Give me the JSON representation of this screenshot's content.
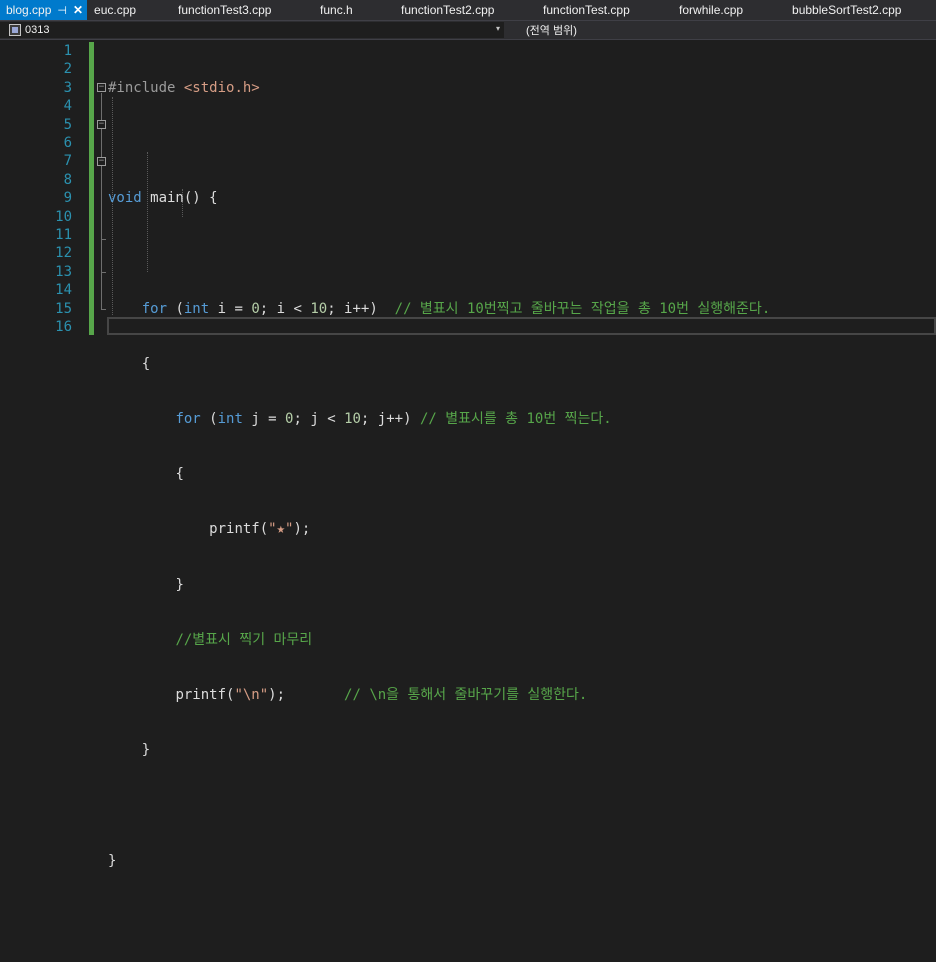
{
  "tabs": [
    {
      "label": "blog.cpp",
      "active": true
    },
    {
      "label": "euc.cpp"
    },
    {
      "label": "functionTest3.cpp"
    },
    {
      "label": "func.h"
    },
    {
      "label": "functionTest2.cpp"
    },
    {
      "label": "functionTest.cpp"
    },
    {
      "label": "forwhile.cpp"
    },
    {
      "label": "bubbleSortTest2.cpp"
    }
  ],
  "tab_pin_glyph": "⊣",
  "tab_close_glyph": "✕",
  "navbar": {
    "project": "0313",
    "scope": "(전역 범위)",
    "dropdown_glyph": "▾"
  },
  "line_numbers": [
    "1",
    "2",
    "3",
    "4",
    "5",
    "6",
    "7",
    "8",
    "9",
    "10",
    "11",
    "12",
    "13",
    "14",
    "15",
    "16"
  ],
  "code": {
    "l1_directive": "#include",
    "l1_header": "<stdio.h>",
    "l3_kw": "void",
    "l3_rest": " main() {",
    "l5_kw_for": "for",
    "l5_paren": " (",
    "l5_kw_int": "int",
    "l5_mid1": " i = ",
    "l5_num0": "0",
    "l5_mid2": "; i < ",
    "l5_num10": "10",
    "l5_mid3": "; i++)  ",
    "l5_comment": "// 별표시 10번찍고 줄바꾸는 작업을 총 10번 실행해준다.",
    "l6_brace": "{",
    "l7_kw_for": "for",
    "l7_paren": " (",
    "l7_kw_int": "int",
    "l7_mid1": " j = ",
    "l7_num0": "0",
    "l7_mid2": "; j < ",
    "l7_num10": "10",
    "l7_mid3": "; j++) ",
    "l7_comment": "// 별표시를 총 10번 찍는다.",
    "l8_brace": "{",
    "l9_call": "printf(",
    "l9_str": "\"★\"",
    "l9_end": ");",
    "l10_brace": "}",
    "l11_comment": "//별표시 찍기 마무리",
    "l12_call": "printf(",
    "l12_str": "\"\\n\"",
    "l12_end": ");       ",
    "l12_comment": "// \\n을 통해서 줄바꾸기를 실행한다.",
    "l13_brace": "}",
    "l15_brace": "}"
  },
  "colors": {
    "tab_active": "#007acc",
    "keyword": "#569cd6",
    "comment": "#57a64a",
    "string": "#d69d85",
    "line_number": "#2b91af",
    "background": "#1e1e1e"
  }
}
